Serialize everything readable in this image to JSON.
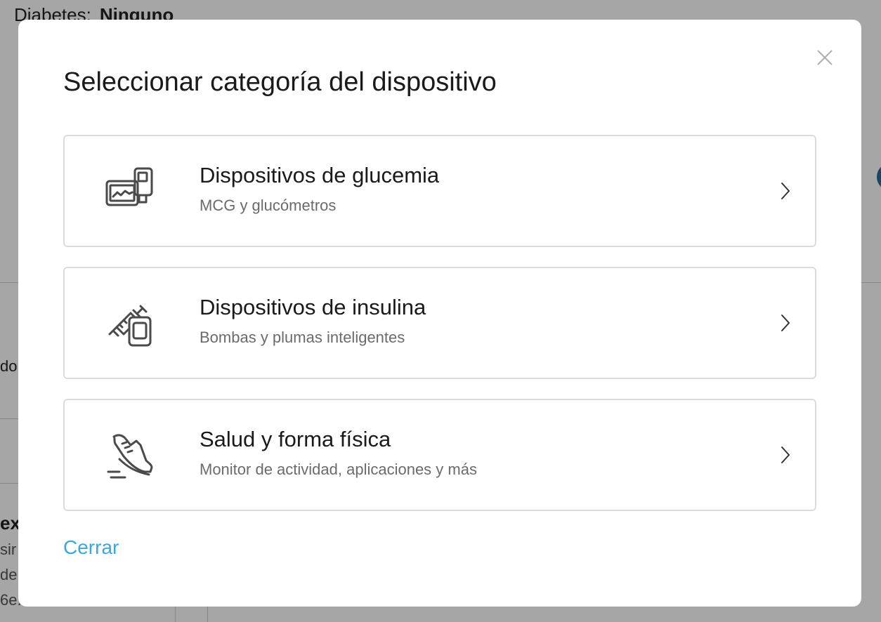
{
  "background": {
    "diabetes_label": "Diabetes:",
    "diabetes_value": "Ninguno",
    "fragments": [
      "do",
      "exc",
      "sir",
      "de ,",
      "6e."
    ]
  },
  "modal": {
    "title": "Seleccionar categoría del dispositivo",
    "close_icon": "close-icon",
    "categories": [
      {
        "icon": "glucose-meter-icon",
        "title": "Dispositivos de glucemia",
        "subtitle": "MCG y glucómetros"
      },
      {
        "icon": "insulin-syringe-icon",
        "title": "Dispositivos de insulina",
        "subtitle": "Bombas y plumas inteligentes"
      },
      {
        "icon": "running-shoe-icon",
        "title": "Salud y forma física",
        "subtitle": "Monitor de actividad, aplicaciones y más"
      }
    ],
    "close_link": "Cerrar"
  },
  "colors": {
    "link": "#3aa7e0",
    "card_border": "#dcdcdc",
    "icon_stroke": "#4a4a4a",
    "subtitle": "#6b6b6b"
  }
}
